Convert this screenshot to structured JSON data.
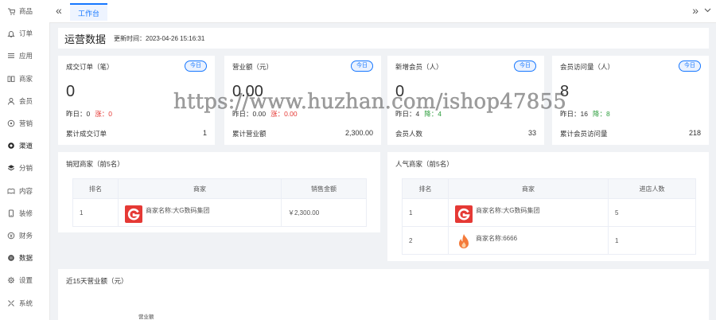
{
  "sidebar": {
    "items": [
      {
        "label": "商品",
        "icon": "cart-icon"
      },
      {
        "label": "订单",
        "icon": "bell-icon"
      },
      {
        "label": "应用",
        "icon": "list-icon"
      },
      {
        "label": "商家",
        "icon": "store-icon"
      },
      {
        "label": "会员",
        "icon": "user-icon"
      },
      {
        "label": "营销",
        "icon": "tag-icon"
      },
      {
        "label": "渠道",
        "icon": "channel-icon"
      },
      {
        "label": "分销",
        "icon": "layers-icon"
      },
      {
        "label": "内容",
        "icon": "book-icon"
      },
      {
        "label": "装修",
        "icon": "phone-icon"
      },
      {
        "label": "财务",
        "icon": "coin-icon"
      },
      {
        "label": "数据",
        "icon": "database-icon"
      },
      {
        "label": "设置",
        "icon": "gear-icon"
      },
      {
        "label": "系统",
        "icon": "system-icon"
      }
    ]
  },
  "topbar": {
    "collapse": "«",
    "active_tab": "工作台",
    "expand": "»",
    "dropdown": "⌄"
  },
  "header": {
    "title": "运营数据",
    "update_label": "更新时间：2023-04-26 15:16:31"
  },
  "cards": [
    {
      "title": "成交订单（笔）",
      "badge": "今日",
      "value": "0",
      "yesterday_label": "昨日：",
      "yesterday_value": "0",
      "change_label": "涨：",
      "change_value": "0",
      "change_color": "#e53935",
      "total_label": "累计成交订单",
      "total_value": "1"
    },
    {
      "title": "营业额（元）",
      "badge": "今日",
      "value": "0.00",
      "yesterday_label": "昨日：",
      "yesterday_value": "0.00",
      "change_label": "涨：",
      "change_value": "0.00",
      "change_color": "#e53935",
      "total_label": "累计营业额",
      "total_value": "2,300.00"
    },
    {
      "title": "新增会员（人）",
      "badge": "今日",
      "value": "0",
      "yesterday_label": "昨日：",
      "yesterday_value": "4",
      "change_label": "降：",
      "change_value": "4",
      "change_color": "#2e9e3e",
      "total_label": "会员人数",
      "total_value": "33"
    },
    {
      "title": "会员访问量（人）",
      "badge": "今日",
      "value": "8",
      "yesterday_label": "昨日：",
      "yesterday_value": "16",
      "change_label": "降：",
      "change_value": "8",
      "change_color": "#2e9e3e",
      "total_label": "累计会员访问量",
      "total_value": "218"
    }
  ],
  "sales_rank": {
    "title": "销冠商家（前5名）",
    "columns": [
      "排名",
      "商家",
      "销售金额"
    ],
    "rows": [
      {
        "rank": "1",
        "shop": "商家名称:大G数码集团",
        "logo": "g-logo-icon",
        "amount": "￥2,300.00"
      }
    ]
  },
  "popular_rank": {
    "title": "人气商家（前5名）",
    "columns": [
      "排名",
      "商家",
      "进店人数"
    ],
    "rows": [
      {
        "rank": "1",
        "shop": "商家名称:大G数码集团",
        "logo": "g-logo-icon",
        "visits": "5"
      },
      {
        "rank": "2",
        "shop": "商家名称:6666",
        "logo": "flame-logo-icon",
        "visits": "1"
      }
    ]
  },
  "revenue_chart": {
    "title": "近15天营业额（元）",
    "legend": "营业额"
  },
  "watermark": "https://www.huzhan.com/ishop47855",
  "colors": {
    "accent": "#1677ff",
    "up": "#e53935",
    "down": "#2e9e3e",
    "g_logo": "#e53935",
    "flame_logo": "#f47a3a"
  }
}
